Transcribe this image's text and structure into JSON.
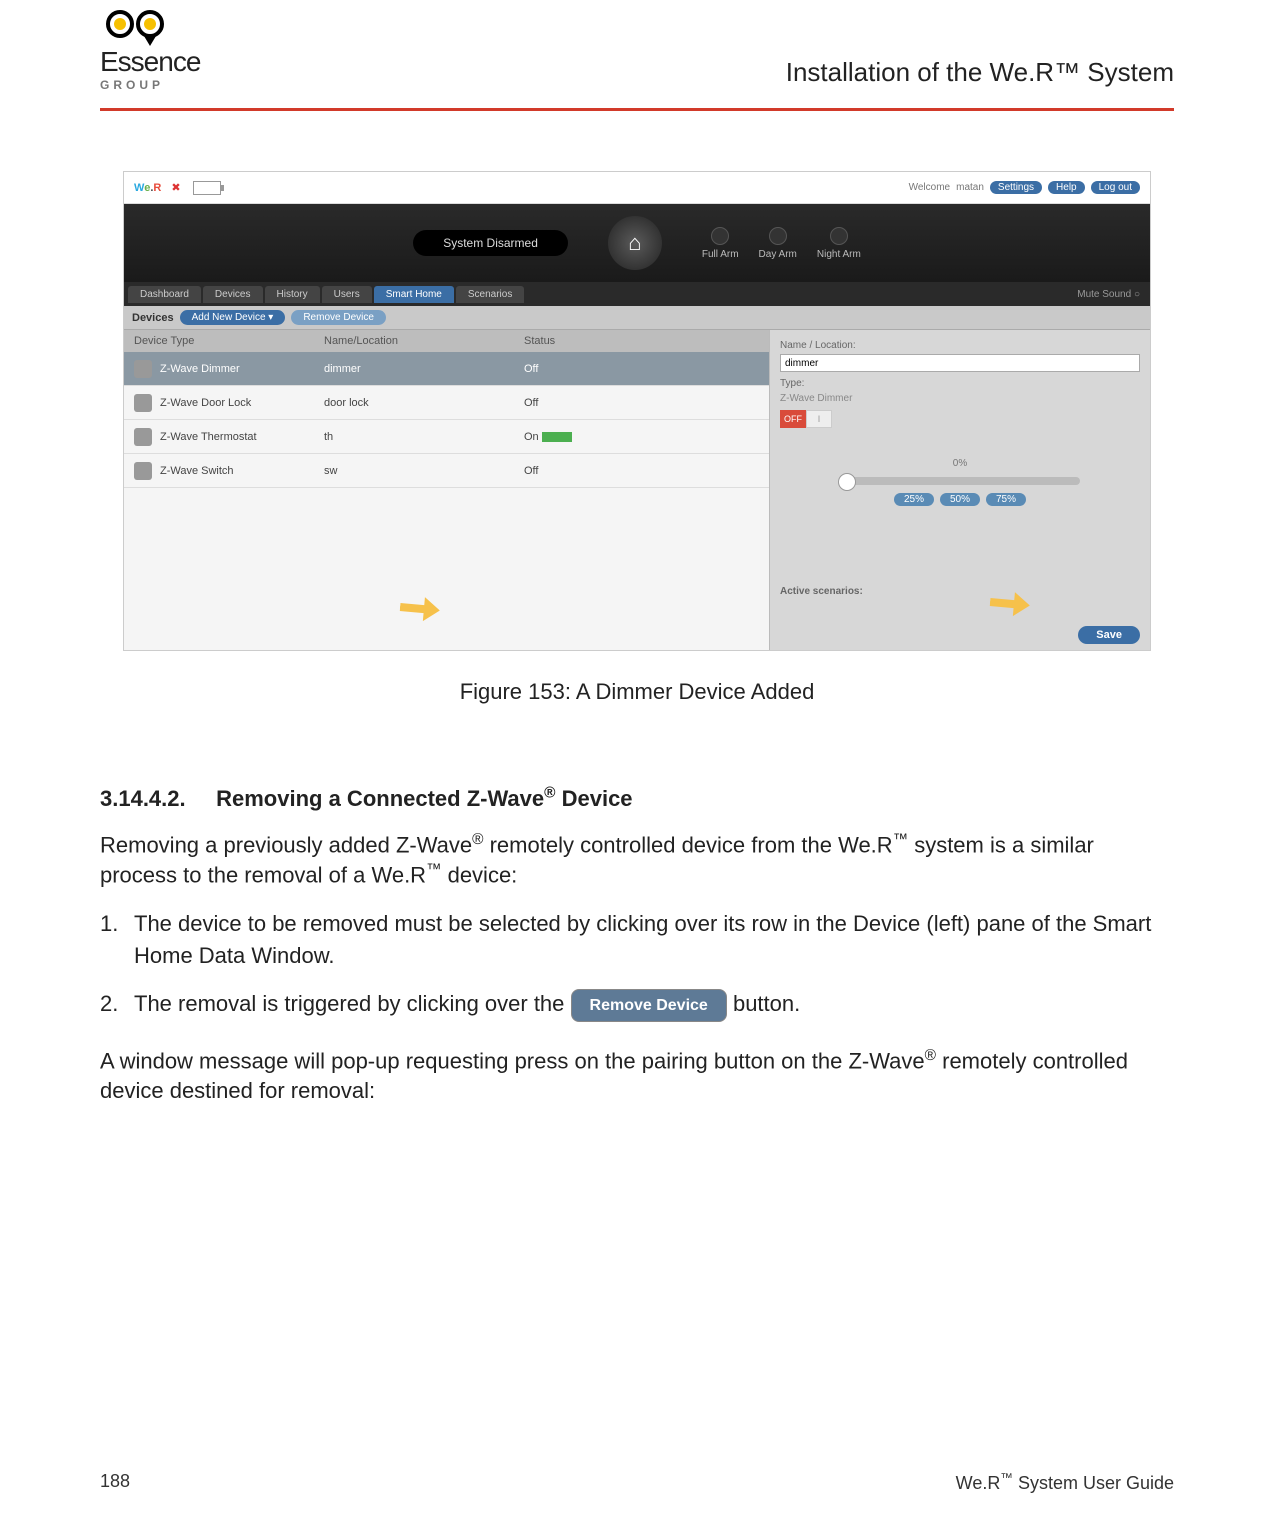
{
  "header": {
    "logo_main": "Essence",
    "logo_sub": "GROUP",
    "title": "Installation of the We.R™ System"
  },
  "screenshot": {
    "welcome_prefix": "Welcome",
    "welcome_user": "matan",
    "top_links": [
      "Settings",
      "Help",
      "Log out"
    ],
    "system_status": "System Disarmed",
    "arm_buttons": [
      "Full Arm",
      "Day Arm",
      "Night Arm"
    ],
    "nav_tabs": [
      "Dashboard",
      "Devices",
      "History",
      "Users",
      "Smart Home",
      "Scenarios"
    ],
    "mute_label": "Mute Sound",
    "subbar_label": "Devices",
    "add_btn": "Add New Device",
    "remove_btn": "Remove Device",
    "columns": [
      "Device Type",
      "Name/Location",
      "Status"
    ],
    "rows": [
      {
        "type": "Z-Wave Dimmer",
        "name": "dimmer",
        "status": "Off",
        "selected": true
      },
      {
        "type": "Z-Wave Door Lock",
        "name": "door lock",
        "status": "Off"
      },
      {
        "type": "Z-Wave Thermostat",
        "name": "th",
        "status": "On",
        "green": true
      },
      {
        "type": "Z-Wave Switch",
        "name": "sw",
        "status": "Off"
      }
    ],
    "right": {
      "name_label": "Name / Location:",
      "name_value": "dimmer",
      "type_label": "Type:",
      "type_value": "Z-Wave Dimmer",
      "off": "OFF",
      "on": "I",
      "percent": "0%",
      "pct_buttons": [
        "25%",
        "50%",
        "75%"
      ],
      "active_scen": "Active scenarios:",
      "save": "Save"
    }
  },
  "caption": "Figure 153: A Dimmer Device Added",
  "section": {
    "number": "3.14.4.2.",
    "title_pre": "Removing a Connected Z-Wave",
    "title_sup": "®",
    "title_post": " Device"
  },
  "para1_a": "Removing a previously added Z-Wave",
  "para1_sup1": "®",
  "para1_b": " remotely controlled device from the We.R",
  "para1_sup2": "™",
  "para1_c": " system is a similar process to the removal of a We.R",
  "para1_sup3": "™",
  "para1_d": " device:",
  "li1": "The device to be removed must be selected by clicking over its row in the Device (left) pane of the Smart Home Data Window.",
  "li2_a": "The removal is triggered by clicking over the ",
  "li2_btn": "Remove Device",
  "li2_b": " button.",
  "para2_a": "A window message will pop-up requesting press on the pairing button on the Z-Wave",
  "para2_sup": "®",
  "para2_b": " remotely controlled device destined for removal:",
  "footer": {
    "page": "188",
    "guide_a": "We.R",
    "guide_sup": "™",
    "guide_b": " System User Guide"
  }
}
